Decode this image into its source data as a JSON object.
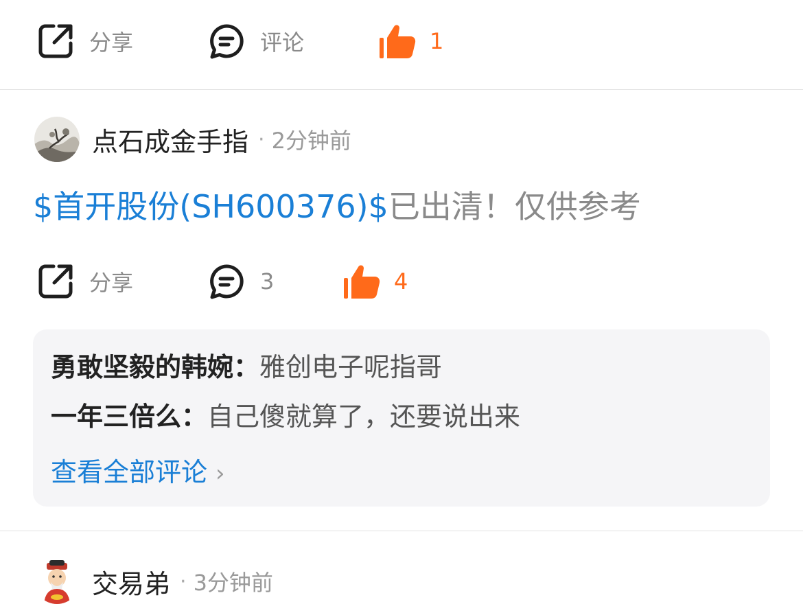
{
  "colors": {
    "accent": "#ff6a1a",
    "link": "#1a7fd6",
    "muted": "#8a8a8a"
  },
  "top_actions": {
    "share_label": "分享",
    "comment_label": "评论",
    "like_count": "1"
  },
  "post": {
    "author": "点石成金手指",
    "dot": "·",
    "time": "2分钟前",
    "stock_link": "$首开股份(SH600376)$",
    "text": "已出清！仅供参考",
    "actions": {
      "share_label": "分享",
      "comment_count": "3",
      "like_count": "4"
    },
    "comments": [
      {
        "author": "勇敢坚毅的韩婉：",
        "text": "雅创电子呢指哥"
      },
      {
        "author": "一年三倍么：",
        "text": "自己傻就算了，还要说出来"
      }
    ],
    "view_all_label": "查看全部评论",
    "view_all_chevron": "›"
  },
  "next_post": {
    "author": "交易弟",
    "dot": "·",
    "time": "3分钟前"
  },
  "icons": {
    "share": "share-icon",
    "comment": "comment-bubble-icon",
    "like": "thumbs-up-icon",
    "chevron": "chevron-right-icon"
  }
}
